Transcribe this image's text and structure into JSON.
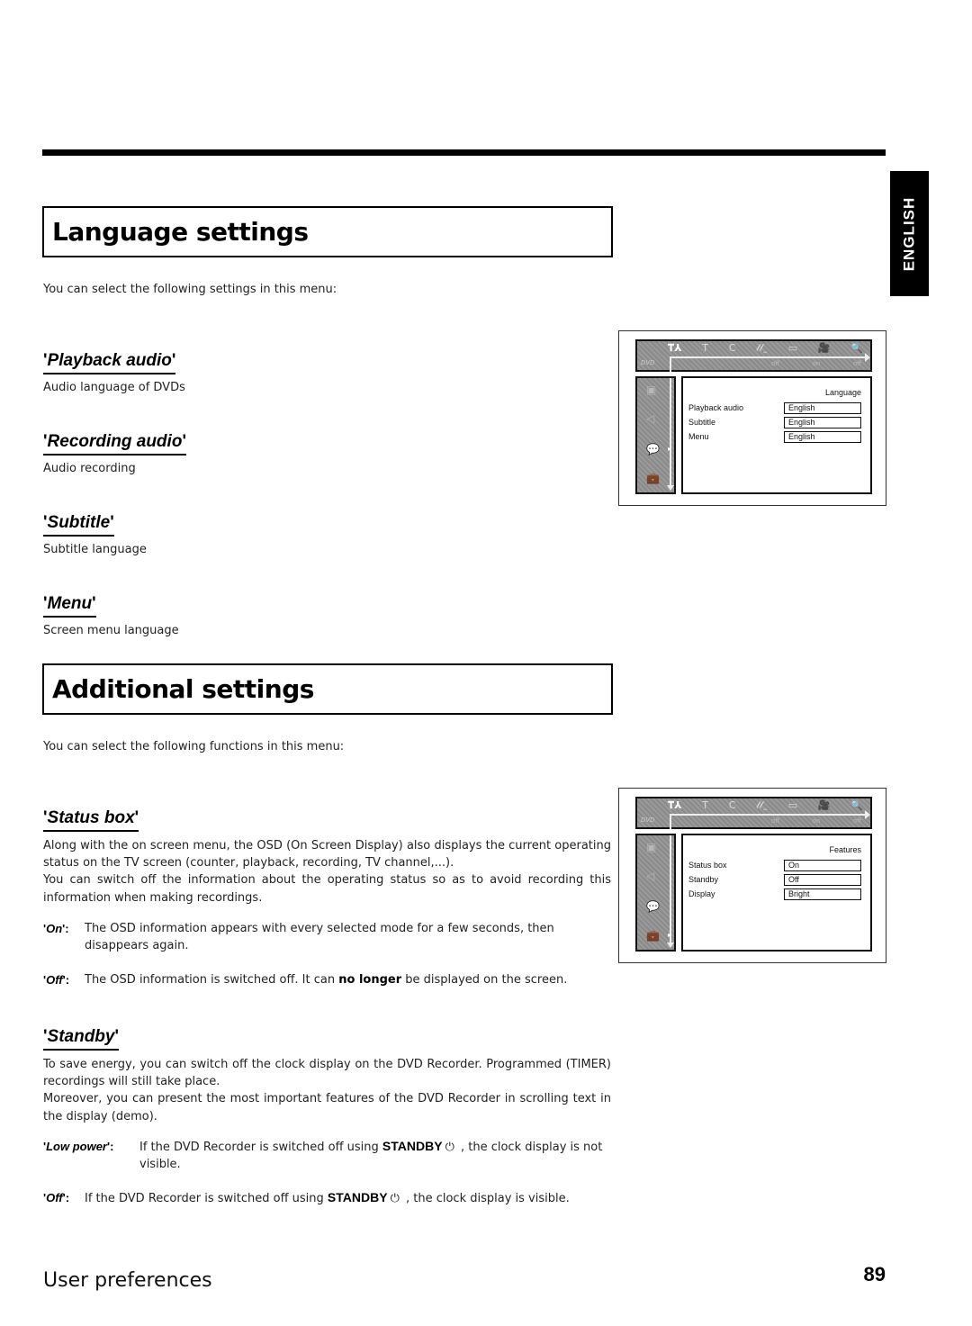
{
  "side_tab": "ENGLISH",
  "language_section": {
    "title": "Language settings",
    "intro": "You can select the following settings in this menu:",
    "items": [
      {
        "name": "Playback audio",
        "desc": "Audio language of DVDs"
      },
      {
        "name": "Recording audio",
        "desc": "Audio recording"
      },
      {
        "name": "Subtitle",
        "desc": "Subtitle language"
      },
      {
        "name": "Menu",
        "desc": "Screen menu language"
      }
    ],
    "osd": {
      "panel_title": "Language",
      "rows": [
        {
          "label": "Playback audio",
          "value": "English"
        },
        {
          "label": "Subtitle",
          "value": "English"
        },
        {
          "label": "Menu",
          "value": "English"
        }
      ]
    }
  },
  "additional_section": {
    "title": "Additional settings",
    "intro": "You can select the following functions in this menu:",
    "status_box": {
      "name": "Status box",
      "para1": "Along with the on screen menu, the OSD (On Screen Display) also displays the current operating status on the TV screen (counter, playback, recording, TV channel,...).",
      "para2": "You can switch off the information about the operating status so as to avoid recording this information when making recordings.",
      "options": [
        {
          "key": "On",
          "text": "The OSD information appears with every selected mode for a few seconds, then disappears again."
        },
        {
          "key": "Off",
          "text_before": "The OSD information is switched off. It can ",
          "bold": "no longer",
          "text_after": " be displayed on the screen."
        }
      ]
    },
    "standby": {
      "name": "Standby",
      "para1": "To save energy, you can switch off the clock display on the DVD Recorder. Programmed (TIMER) recordings will still take place.",
      "para2": "Moreover, you can present the most important features of the DVD Recorder in scrolling text in the display (demo).",
      "options": [
        {
          "key": "Low power",
          "text_before": "If the DVD Recorder is switched off using ",
          "button": "STANDBY",
          "text_after": " , the clock display is not visible."
        },
        {
          "key": "Off",
          "text_before": "If the DVD Recorder is switched off using ",
          "button": "STANDBY",
          "text_after": " , the clock display is visible."
        }
      ]
    },
    "osd": {
      "panel_title": "Features",
      "rows": [
        {
          "label": "Status box",
          "value": "On"
        },
        {
          "label": "Standby",
          "value": "Off"
        },
        {
          "label": "Display",
          "value": "Bright"
        }
      ]
    }
  },
  "osd_common": {
    "top_icons": [
      "TA",
      "T",
      "C",
      "(("
    ],
    "logo": "DVD",
    "sub_icons": [
      "off",
      "on",
      "off"
    ]
  },
  "footer": {
    "section": "User preferences",
    "page": "89"
  }
}
